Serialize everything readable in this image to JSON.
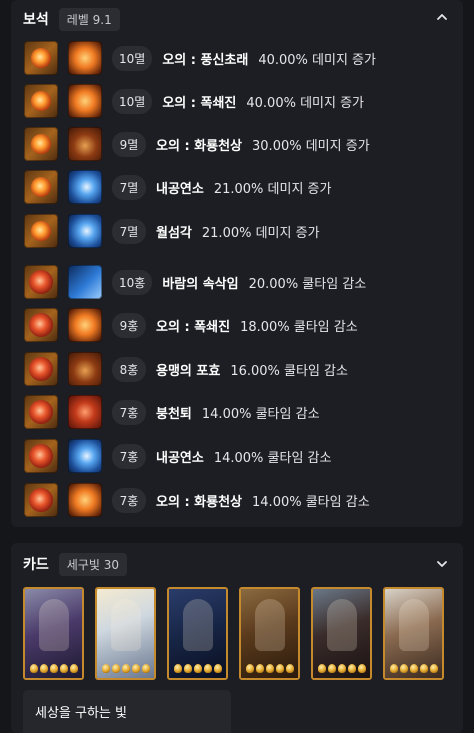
{
  "gems": {
    "title": "보석",
    "badge": "레벨 9.1",
    "rows": [
      {
        "level": "10멸",
        "skill": "오의 : 풍신초래",
        "effect": "40.00% 데미지 증가"
      },
      {
        "level": "10멸",
        "skill": "오의 : 폭쇄진",
        "effect": "40.00% 데미지 증가"
      },
      {
        "level": "9멸",
        "skill": "오의 : 화룡천상",
        "effect": "30.00% 데미지 증가"
      },
      {
        "level": "7멸",
        "skill": "내공연소",
        "effect": "21.00% 데미지 증가"
      },
      {
        "level": "7멸",
        "skill": "월섬각",
        "effect": "21.00% 데미지 증가"
      },
      {
        "level": "10홍",
        "skill": "바람의 속삭임",
        "effect": "20.00% 쿨타임 감소"
      },
      {
        "level": "9홍",
        "skill": "오의 : 폭쇄진",
        "effect": "18.00% 쿨타임 감소"
      },
      {
        "level": "8홍",
        "skill": "용맹의 포효",
        "effect": "16.00% 쿨타임 감소"
      },
      {
        "level": "7홍",
        "skill": "붕천퇴",
        "effect": "14.00% 쿨타임 감소"
      },
      {
        "level": "7홍",
        "skill": "내공연소",
        "effect": "14.00% 쿨타임 감소"
      },
      {
        "level": "7홍",
        "skill": "오의 : 화룡천상",
        "effect": "14.00% 쿨타임 감소"
      }
    ]
  },
  "cards": {
    "title": "카드",
    "badge": "세구빛 30",
    "set_name": "세상을 구하는 빛"
  }
}
